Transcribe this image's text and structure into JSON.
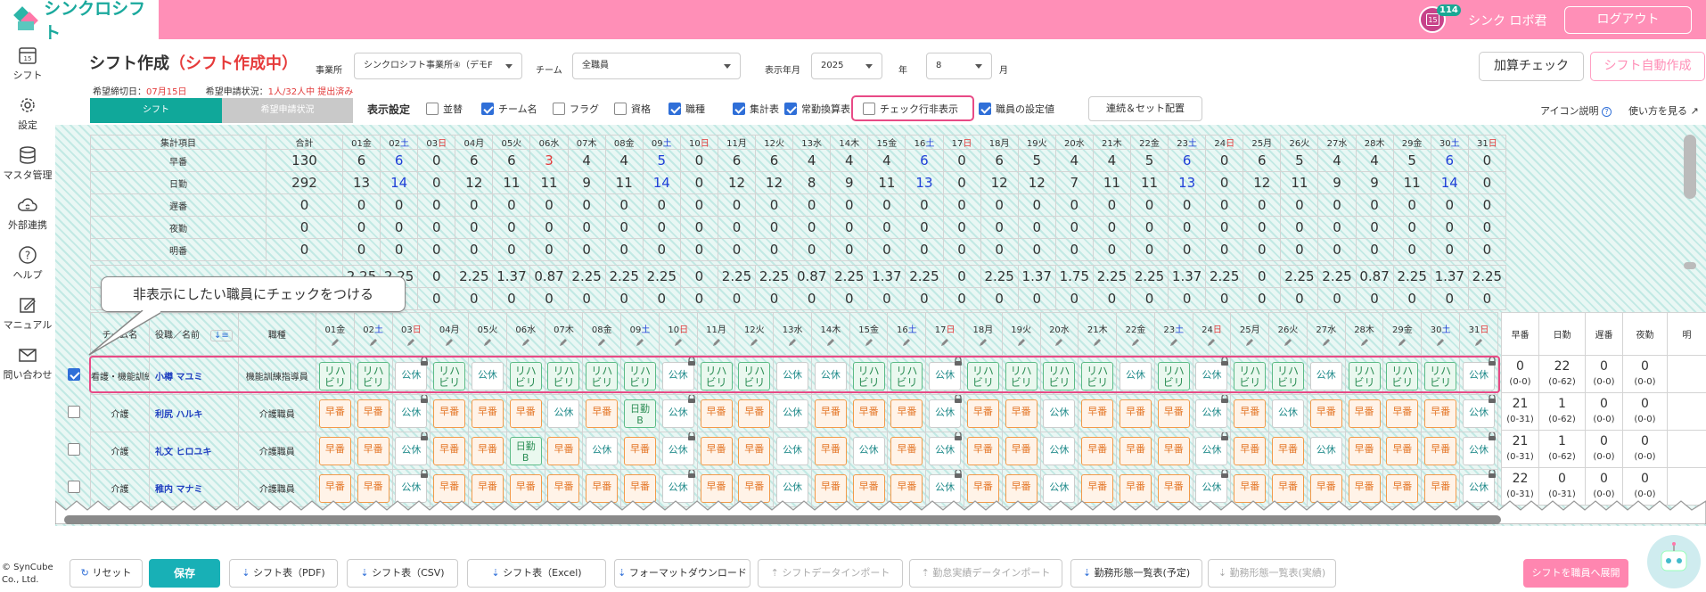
{
  "app": {
    "logo_text": "シンクロシフト",
    "notification_count": "114",
    "calendar_day": "15",
    "user_name": "シンク ロボ君",
    "logout_label": "ログアウト"
  },
  "sidebar": [
    {
      "label": "シフト",
      "icon": "calendar-icon"
    },
    {
      "label": "設定",
      "icon": "gear-icon"
    },
    {
      "label": "マスタ管理",
      "icon": "database-icon"
    },
    {
      "label": "外部連携",
      "icon": "cloud-sync-icon"
    },
    {
      "label": "ヘルプ",
      "icon": "help-icon"
    },
    {
      "label": "マニュアル",
      "icon": "pencil-note-icon"
    },
    {
      "label": "問い合わせ",
      "icon": "mail-icon"
    }
  ],
  "header": {
    "title": "シフト作成",
    "status": "（シフト作成中）",
    "office_label": "事業所",
    "office_value": "シンクロシフト事業所④（デモF",
    "team_label": "チーム",
    "team_value": "全職員",
    "period_label": "表示年月",
    "year_value": "2025",
    "year_unit": "年",
    "month_value": "8",
    "month_unit": "月",
    "deadline_label": "希望締切日：",
    "deadline_value": "07月15日",
    "request_label": "希望申請状況：",
    "request_value": "1人/32人中 提出済み",
    "check_button": "加算チェック",
    "auto_button": "シフト自動作成"
  },
  "tabs": {
    "shift": "シフト",
    "request": "希望申請状況"
  },
  "display": {
    "label": "表示設定",
    "options": [
      {
        "label": "並替",
        "checked": false
      },
      {
        "label": "チーム名",
        "checked": true
      },
      {
        "label": "フラグ",
        "checked": false
      },
      {
        "label": "資格",
        "checked": false
      },
      {
        "label": "職種",
        "checked": true
      },
      {
        "label": "集計表",
        "checked": true
      },
      {
        "label": "常勤換算表",
        "checked": true
      },
      {
        "label": "チェック行非表示",
        "checked": false
      },
      {
        "label": "職員の設定値",
        "checked": true
      }
    ],
    "renzoku_button": "連続＆セット配置",
    "icon_help": "アイコン説明",
    "usage": "使い方を見る"
  },
  "summary": {
    "header_label": "集計項目",
    "total_label": "合計",
    "days": [
      "01金",
      "02土",
      "03日",
      "04月",
      "05火",
      "06水",
      "07木",
      "08金",
      "09土",
      "10日",
      "11月",
      "12火",
      "13水",
      "14木",
      "15金",
      "16土",
      "17日",
      "18月",
      "19火",
      "20水",
      "21木",
      "22金",
      "23土",
      "24日",
      "25月",
      "26火",
      "27水",
      "28木",
      "29金",
      "30土",
      "31日"
    ],
    "rows": [
      {
        "label": "早番",
        "total": "130",
        "values": [
          "6",
          "6",
          "0",
          "6",
          "6",
          "3",
          "4",
          "4",
          "5",
          "0",
          "6",
          "6",
          "4",
          "4",
          "4",
          "6",
          "0",
          "6",
          "5",
          "4",
          "4",
          "5",
          "6",
          "0",
          "6",
          "5",
          "4",
          "4",
          "5",
          "6",
          "0"
        ]
      },
      {
        "label": "日勤",
        "total": "292",
        "values": [
          "13",
          "14",
          "0",
          "12",
          "11",
          "11",
          "9",
          "11",
          "14",
          "0",
          "12",
          "12",
          "8",
          "9",
          "11",
          "13",
          "0",
          "12",
          "12",
          "7",
          "11",
          "11",
          "13",
          "0",
          "12",
          "11",
          "9",
          "9",
          "11",
          "14",
          "0"
        ]
      },
      {
        "label": "遅番",
        "total": "0",
        "values": [
          "0",
          "0",
          "0",
          "0",
          "0",
          "0",
          "0",
          "0",
          "0",
          "0",
          "0",
          "0",
          "0",
          "0",
          "0",
          "0",
          "0",
          "0",
          "0",
          "0",
          "0",
          "0",
          "0",
          "0",
          "0",
          "0",
          "0",
          "0",
          "0",
          "0",
          "0"
        ]
      },
      {
        "label": "夜勤",
        "total": "0",
        "values": [
          "0",
          "0",
          "0",
          "0",
          "0",
          "0",
          "0",
          "0",
          "0",
          "0",
          "0",
          "0",
          "0",
          "0",
          "0",
          "0",
          "0",
          "0",
          "0",
          "0",
          "0",
          "0",
          "0",
          "0",
          "0",
          "0",
          "0",
          "0",
          "0",
          "0",
          "0"
        ]
      },
      {
        "label": "明番",
        "total": "0",
        "values": [
          "0",
          "0",
          "0",
          "0",
          "0",
          "0",
          "0",
          "0",
          "0",
          "0",
          "0",
          "0",
          "0",
          "0",
          "0",
          "0",
          "0",
          "0",
          "0",
          "0",
          "0",
          "0",
          "0",
          "0",
          "0",
          "0",
          "0",
          "0",
          "0",
          "0",
          "0"
        ]
      }
    ],
    "fte_row": {
      "total": "",
      "values": [
        "2.25",
        "2.25",
        "0",
        "2.25",
        "1.37",
        "0.87",
        "2.25",
        "2.25",
        "2.25",
        "0",
        "2.25",
        "2.25",
        "0.87",
        "2.25",
        "1.37",
        "2.25",
        "0",
        "2.25",
        "1.37",
        "1.75",
        "2.25",
        "2.25",
        "1.37",
        "2.25",
        "0",
        "2.25",
        "2.25",
        "0.87",
        "2.25",
        "1.37",
        "2.25",
        "2.25",
        "0"
      ]
    },
    "fte_values": [
      "2.25",
      "2.25",
      "0",
      "2.25",
      "1.37",
      "0.87",
      "2.25",
      "2.25",
      "2.25",
      "0",
      "2.25",
      "2.25",
      "0.87",
      "2.25",
      "1.37",
      "2.25",
      "0",
      "2.25",
      "1.37",
      "1.75",
      "2.25",
      "2.25",
      "1.37",
      "2.25",
      "0",
      "2.25",
      "2.25",
      "0.87",
      "2.25",
      "1.37",
      "2.25",
      "2.25",
      "0"
    ],
    "zero_values": [
      "0",
      "0",
      "0",
      "0",
      "0",
      "0",
      "0",
      "0",
      "0",
      "0",
      "0",
      "0",
      "0",
      "0",
      "0",
      "0",
      "0",
      "0",
      "0",
      "0",
      "0",
      "0",
      "0",
      "0",
      "0",
      "0",
      "0",
      "0",
      "0",
      "0",
      "0"
    ]
  },
  "staff_header": {
    "team": "チーム名",
    "name": "役職／名前",
    "job": "職種"
  },
  "right_summary_headers": [
    "早番",
    "日勤",
    "遅番",
    "夜勤",
    "明"
  ],
  "staff": [
    {
      "checked": true,
      "team": "看護・機能訓練",
      "name": "小樽 マユミ",
      "job": "機能訓練指導員",
      "shifts": [
        "R",
        "R",
        "K",
        "R",
        "K",
        "R",
        "R",
        "R",
        "R",
        "K",
        "R",
        "R",
        "K",
        "K",
        "R",
        "R",
        "K",
        "R",
        "R",
        "R",
        "R",
        "K",
        "R",
        "K",
        "R",
        "R",
        "K",
        "R",
        "R",
        "R",
        "K"
      ],
      "sum": [
        {
          "v": "0",
          "r": "(0-0)"
        },
        {
          "v": "22",
          "r": "(0-62)"
        },
        {
          "v": "0",
          "r": "(0-0)"
        },
        {
          "v": "0",
          "r": "(0-0)"
        }
      ]
    },
    {
      "checked": false,
      "team": "介護",
      "name": "利尻 ハルキ",
      "job": "介護職員",
      "shifts": [
        "H",
        "H",
        "K",
        "H",
        "H",
        "H",
        "K",
        "H",
        "N",
        "K",
        "H",
        "H",
        "K",
        "H",
        "H",
        "H",
        "K",
        "H",
        "H",
        "K",
        "H",
        "H",
        "H",
        "K",
        "H",
        "K",
        "H",
        "H",
        "H",
        "H",
        "K"
      ],
      "sum": [
        {
          "v": "21",
          "r": "(0-31)"
        },
        {
          "v": "1",
          "r": "(0-62)"
        },
        {
          "v": "0",
          "r": "(0-0)"
        },
        {
          "v": "0",
          "r": "(0-0)"
        }
      ]
    },
    {
      "checked": false,
      "team": "介護",
      "name": "礼文 ヒロユキ",
      "job": "介護職員",
      "shifts": [
        "H",
        "H",
        "K",
        "H",
        "H",
        "N",
        "H",
        "K",
        "H",
        "K",
        "H",
        "H",
        "K",
        "H",
        "K",
        "H",
        "K",
        "H",
        "H",
        "K",
        "H",
        "H",
        "H",
        "K",
        "H",
        "H",
        "K",
        "H",
        "H",
        "H",
        "K"
      ],
      "sum": [
        {
          "v": "21",
          "r": "(0-31)"
        },
        {
          "v": "1",
          "r": "(0-62)"
        },
        {
          "v": "0",
          "r": "(0-0)"
        },
        {
          "v": "0",
          "r": "(0-0)"
        }
      ]
    },
    {
      "checked": false,
      "team": "介護",
      "name": "稚内 マナミ",
      "job": "介護職員",
      "shifts": [
        "H",
        "H",
        "K",
        "H",
        "H",
        "H",
        "H",
        "H",
        "H",
        "K",
        "H",
        "H",
        "K",
        "H",
        "H",
        "H",
        "K",
        "H",
        "H",
        "K",
        "H",
        "H",
        "H",
        "K",
        "H",
        "H",
        "H",
        "H",
        "H",
        "H",
        "K"
      ],
      "sum": [
        {
          "v": "22",
          "r": "(0-31)"
        },
        {
          "v": "0",
          "r": "(0-31)"
        },
        {
          "v": "0",
          "r": "(0-0)"
        },
        {
          "v": "0",
          "r": "(0-0)"
        }
      ]
    }
  ],
  "shift_codes": {
    "R": "リハビリ",
    "H": "早番",
    "K": "公休",
    "N": "日勤B"
  },
  "callout": "非表示にしたい職員にチェックをつける",
  "bottom": {
    "copyright": "© SynCube Co., Ltd.",
    "buttons": [
      "リセット",
      "保存",
      "シフト表（PDF)",
      "シフト表（CSV)",
      "シフト表（Excel)",
      "フォーマットダウンロード",
      "シフトデータインポート",
      "勤怠実績データインポート",
      "勤務形態一覧表(予定)",
      "勤務形態一覧表(実績)"
    ],
    "publish": "シフトを職員へ展開"
  },
  "colors": {
    "brand_pink": "#ff8fb7",
    "teal": "#10a89a",
    "highlight": "#e84a86"
  }
}
